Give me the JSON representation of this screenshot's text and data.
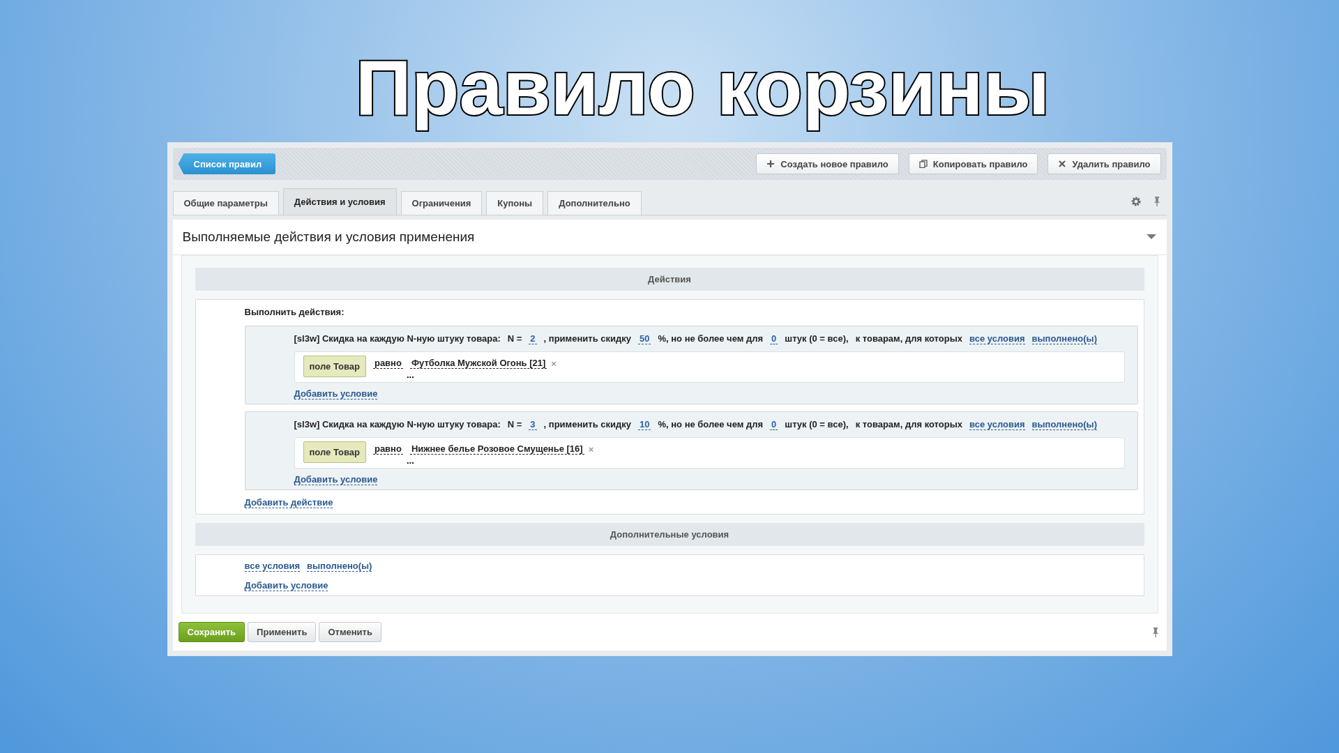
{
  "slide_title": "Правило корзины",
  "toolbar": {
    "back_button": "Список правил",
    "buttons": [
      {
        "kind": "create",
        "label": "Создать новое правило"
      },
      {
        "kind": "copy",
        "label": "Копировать правило"
      },
      {
        "kind": "delete",
        "label": "Удалить правило"
      }
    ]
  },
  "tabs": [
    {
      "label": "Общие параметры",
      "selected": false
    },
    {
      "label": "Действия и условия",
      "selected": true
    },
    {
      "label": "Ограничения",
      "selected": false
    },
    {
      "label": "Купоны",
      "selected": false
    },
    {
      "label": "Дополнительно",
      "selected": false
    }
  ],
  "section_title": "Выполняемые действия и условия применения",
  "actions_header": "Действия",
  "actions_label": "Выполнить действия:",
  "actions": [
    {
      "prefix": "[sl3w] Скидка на каждую N-ную штуку товара:",
      "n_label": "N =",
      "n": "2",
      "discount_label": ", применить скидку",
      "discount": "50",
      "limit_label": "%, но не более чем для",
      "limit": "0",
      "limit_suffix": "штук (0 = все),",
      "target_label": "к товарам, для которых",
      "all_conditions": "все условия",
      "fulfilled": "выполнено(ы)",
      "condition": {
        "field": "поле Товар",
        "operator": "равно",
        "value": "Футболка Мужской Огонь [21]",
        "remove": "×",
        "more": "..."
      },
      "add_condition": "Добавить условие"
    },
    {
      "prefix": "[sl3w] Скидка на каждую N-ную штуку товара:",
      "n_label": "N =",
      "n": "3",
      "discount_label": ", применить скидку",
      "discount": "10",
      "limit_label": "%, но не более чем для",
      "limit": "0",
      "limit_suffix": "штук (0 = все),",
      "target_label": "к товарам, для которых",
      "all_conditions": "все условия",
      "fulfilled": "выполнено(ы)",
      "condition": {
        "field": "поле Товар",
        "operator": "равно",
        "value": "Нижнее белье Розовое Смущенье [16]",
        "remove": "×",
        "more": "..."
      },
      "add_condition": "Добавить условие"
    }
  ],
  "add_action": "Добавить действие",
  "extra": {
    "header": "Дополнительные условия",
    "all_conditions": "все условия",
    "fulfilled": "выполнено(ы)",
    "add_condition": "Добавить условие"
  },
  "footer_buttons": [
    {
      "kind": "primary",
      "label": "Сохранить"
    },
    {
      "kind": "default",
      "label": "Применить"
    },
    {
      "kind": "default",
      "label": "Отменить"
    }
  ]
}
